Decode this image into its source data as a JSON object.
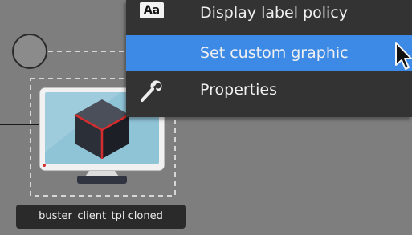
{
  "canvas": {
    "node": {
      "label": "buster_client_tpl cloned",
      "icon": "monitor-with-cube-icon"
    },
    "port_icon": "circle-port-icon"
  },
  "context_menu": {
    "items": [
      {
        "label": "Display label policy",
        "icon": "text-aa-icon",
        "highlighted": false
      },
      {
        "label": "Set custom graphic",
        "icon": "",
        "highlighted": true
      },
      {
        "label": "Properties",
        "icon": "wrench-icon",
        "highlighted": false
      }
    ],
    "aa_glyph": "Aa",
    "highlight_color": "#3c8ae6",
    "background_color": "#333333"
  },
  "cursor_icon": "arrow-pointer-icon"
}
